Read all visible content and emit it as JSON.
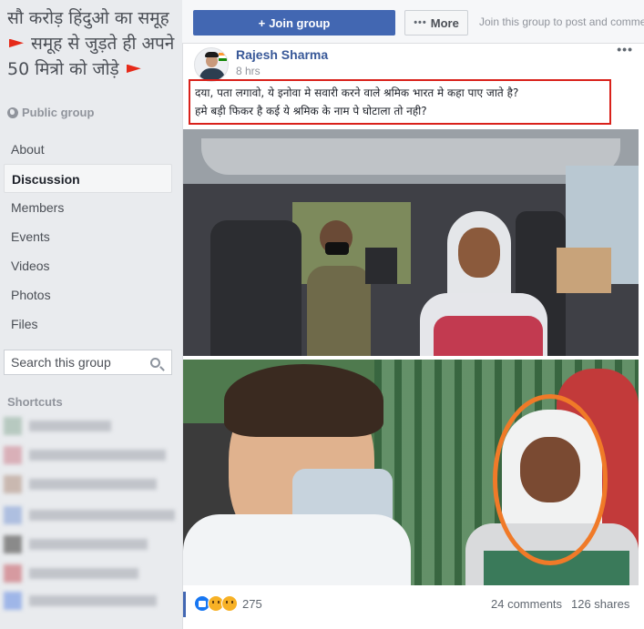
{
  "group": {
    "title_part1": "सौ करोड़ हिंदुओ का समूह",
    "title_part2": "समूह से जुड़ते ही अपने 50 मित्रो को जोड़े",
    "privacy": "Public group"
  },
  "sidebar": {
    "nav": [
      {
        "label": "About"
      },
      {
        "label": "Discussion"
      },
      {
        "label": "Members"
      },
      {
        "label": "Events"
      },
      {
        "label": "Videos"
      },
      {
        "label": "Photos"
      },
      {
        "label": "Files"
      }
    ],
    "search_placeholder": "Search this group",
    "shortcuts_label": "Shortcuts"
  },
  "toolbar": {
    "join_label": "Join group",
    "join_icon": "+",
    "more_label": "More",
    "join_hint": "Join this group to post and comme"
  },
  "post": {
    "author": "Rajesh Sharma",
    "time": "8 hrs",
    "text_line1": "दया, पता लगावो, ये इनोवा मे सवारी करने वाले श्रमिक भारत मे कहा पाए जाते है?",
    "text_line2": "हमे बड़ी फिकर है कई ये श्रमिक के नाम पे घोटाला तो नही?",
    "menu_icon": "•••",
    "reaction_count": "275",
    "comments": "24 comments",
    "shares": "126 shares"
  },
  "colors": {
    "accent": "#4267b2",
    "highlight_box": "#d9211b",
    "circle_annotation": "#f07a28"
  }
}
